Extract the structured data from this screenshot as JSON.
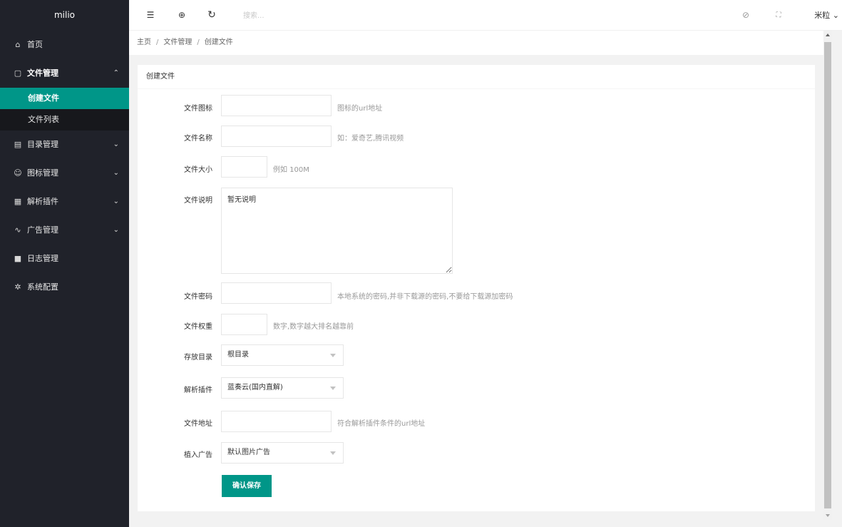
{
  "app": {
    "logo": "milio"
  },
  "sidebar": {
    "items": [
      {
        "icon": "⌂",
        "icon_name": "home-icon",
        "label": "首页"
      },
      {
        "icon": "▢",
        "icon_name": "file-icon",
        "label": "文件管理",
        "arrow": "⌃"
      },
      {
        "icon": "▤",
        "icon_name": "directory-icon",
        "label": "目录管理",
        "arrow": "⌄"
      },
      {
        "icon": "☺",
        "icon_name": "smile-icon",
        "label": "图标管理",
        "arrow": "⌄"
      },
      {
        "icon": "▦",
        "icon_name": "plugin-icon",
        "label": "解析插件",
        "arrow": "⌄"
      },
      {
        "icon": "∿",
        "icon_name": "pulse-icon",
        "label": "广告管理",
        "arrow": "⌄"
      },
      {
        "icon": "■",
        "icon_name": "log-icon",
        "label": "日志管理"
      },
      {
        "icon": "✲",
        "icon_name": "settings-icon",
        "label": "系统配置"
      }
    ],
    "file_submenu": [
      {
        "label": "创建文件",
        "active": true
      },
      {
        "label": "文件列表",
        "active": false
      }
    ]
  },
  "header": {
    "menu_icon": "☰",
    "globe_icon": "⊕",
    "refresh_icon": "↻",
    "search_placeholder": "搜索...",
    "tag_icon": "⊘",
    "fullscreen_icon": "⛶",
    "user_name": "米粒",
    "user_caret": "⌄"
  },
  "breadcrumb": {
    "items": [
      "主页",
      "文件管理",
      "创建文件"
    ],
    "separator": "/"
  },
  "form": {
    "title": "创建文件",
    "icon_label": "文件图标",
    "icon_value": "",
    "icon_hint": "图标的url地址",
    "name_label": "文件名称",
    "name_value": "",
    "name_hint": "如：爱奇艺,腾讯视频",
    "size_label": "文件大小",
    "size_value": "",
    "size_hint": "例如 100M",
    "desc_label": "文件说明",
    "desc_value": "暂无说明",
    "password_label": "文件密码",
    "password_value": "",
    "password_hint": "本地系统的密码,并非下载源的密码,不要给下载源加密码",
    "weight_label": "文件权重",
    "weight_value": "",
    "weight_hint": "数字,数字越大排名越靠前",
    "dir_label": "存放目录",
    "dir_value": "根目录",
    "plugin_label": "解析插件",
    "plugin_value": "蓝奏云(国内直解)",
    "url_label": "文件地址",
    "url_value": "",
    "url_hint": "符合解析插件条件的url地址",
    "ad_label": "植入广告",
    "ad_value": "默认图片广告",
    "save_label": "确认保存"
  },
  "colors": {
    "sidebar_bg": "#20222a",
    "submenu_bg": "#17181c",
    "accent": "#009688",
    "page_bg": "#f2f2f2"
  }
}
